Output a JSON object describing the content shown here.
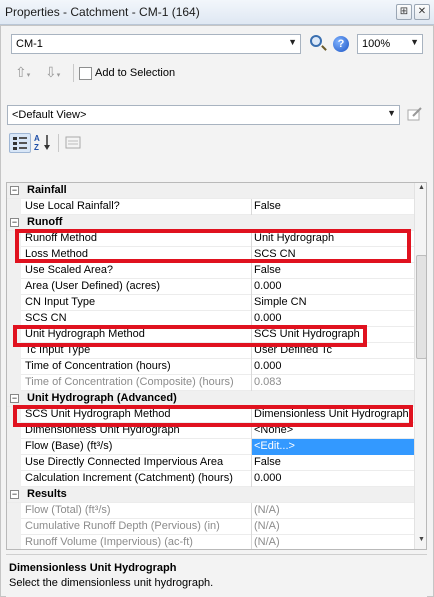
{
  "window": {
    "title": "Properties - Catchment - CM-1 (164)",
    "pin_glyph": "⊞",
    "close_glyph": "✕"
  },
  "toolbar": {
    "element_select": "CM-1",
    "zoom_level": "100%",
    "add_to_selection_label": "Add to Selection",
    "view_select": "<Default View>"
  },
  "grid": {
    "rows": [
      {
        "type": "category",
        "name": "Rainfall"
      },
      {
        "type": "prop",
        "name": "Use Local Rainfall?",
        "value": "False"
      },
      {
        "type": "category",
        "name": "Runoff"
      },
      {
        "type": "prop",
        "name": "Runoff Method",
        "value": "Unit Hydrograph"
      },
      {
        "type": "prop",
        "name": "Loss Method",
        "value": "SCS CN"
      },
      {
        "type": "prop",
        "name": "Use Scaled Area?",
        "value": "False"
      },
      {
        "type": "prop",
        "name": "Area (User Defined) (acres)",
        "value": "0.000"
      },
      {
        "type": "prop",
        "name": "CN Input Type",
        "value": "Simple CN"
      },
      {
        "type": "prop",
        "name": "SCS CN",
        "value": "0.000"
      },
      {
        "type": "prop",
        "name": "Unit Hydrograph Method",
        "value": "SCS Unit Hydrograph"
      },
      {
        "type": "prop",
        "name": "Tc Input Type",
        "value": "User Defined Tc"
      },
      {
        "type": "prop",
        "name": "Time of Concentration (hours)",
        "value": "0.000"
      },
      {
        "type": "disabled",
        "name": "Time of Concentration (Composite) (hours)",
        "value": "0.083"
      },
      {
        "type": "category",
        "name": "Unit Hydrograph (Advanced)"
      },
      {
        "type": "prop",
        "name": "SCS Unit Hydrograph Method",
        "value": "Dimensionless Unit Hydrograph"
      },
      {
        "type": "prop",
        "name": "Dimensionless Unit Hydrograph",
        "value": "<None>"
      },
      {
        "type": "selected",
        "name": "Flow (Base) (ft³/s)",
        "value": "<Edit...>"
      },
      {
        "type": "prop",
        "name": "Use Directly Connected Impervious Area",
        "value": "False"
      },
      {
        "type": "prop",
        "name": "Calculation Increment (Catchment) (hours)",
        "value": "0.000"
      },
      {
        "type": "category",
        "name": "Results"
      },
      {
        "type": "disabled",
        "name": "Flow (Total) (ft³/s)",
        "value": "(N/A)"
      },
      {
        "type": "disabled",
        "name": "Cumulative Runoff Depth (Pervious) (in)",
        "value": "(N/A)"
      },
      {
        "type": "disabled",
        "name": "Runoff Volume (Impervious) (ac-ft)",
        "value": "(N/A)"
      }
    ]
  },
  "description": {
    "title": "Dimensionless Unit Hydrograph",
    "text": "Select the dimensionless unit hydrograph."
  },
  "colors": {
    "highlight": "#e0121f",
    "selection": "#3399ff"
  }
}
